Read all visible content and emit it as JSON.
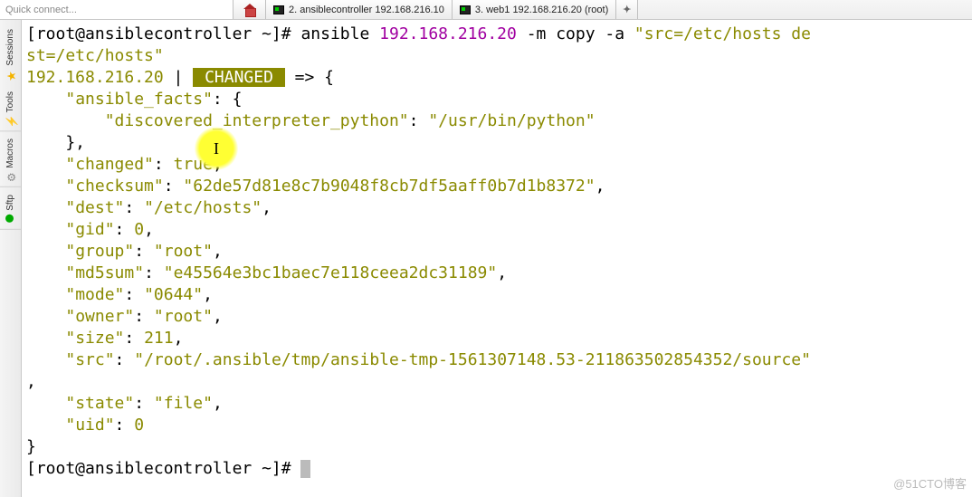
{
  "tabbar": {
    "quick_connect_placeholder": "Quick connect...",
    "tab2": "2. ansiblecontroller 192.168.216.10",
    "tab3": "3. web1 192.168.216.20 (root)",
    "newtab": "✦"
  },
  "sidebar": {
    "sessions": "Sessions",
    "tools": "Tools",
    "macros": "Macros",
    "sftp": "Sftp"
  },
  "term": {
    "prompt1a": "[root@ansiblecontroller ~]# ",
    "cmd_name": "ansible ",
    "cmd_ip": "192.168.216.20",
    "cmd_rest1": " -m copy -a ",
    "cmd_q1": "\"src=/etc/hosts de",
    "cmd_q2": "st=/etc/hosts\"",
    "resp_ip": "192.168.216.20",
    "pipe": " | ",
    "changed": " CHANGED ",
    "arrow": " => {",
    "k_facts": "\"ansible_facts\"",
    "open_facts": ": {",
    "k_disc": "\"discovered_interpreter_python\"",
    "v_disc": "\"/usr/bin/python\"",
    "close_facts": "    },",
    "k_changed": "\"changed\"",
    "v_changed": "true",
    "k_checksum": "\"checksum\"",
    "v_checksum": "\"62de57d81e8c7b9048f8cb7df5aaff0b7d1b8372\"",
    "k_dest": "\"dest\"",
    "v_dest": "\"/etc/hosts\"",
    "k_gid": "\"gid\"",
    "v_gid": "0",
    "k_group": "\"group\"",
    "v_group": "\"root\"",
    "k_md5": "\"md5sum\"",
    "v_md5": "\"e45564e3bc1baec7e118ceea2dc31189\"",
    "k_mode": "\"mode\"",
    "v_mode": "\"0644\"",
    "k_owner": "\"owner\"",
    "v_owner": "\"root\"",
    "k_size": "\"size\"",
    "v_size": "211",
    "k_src": "\"src\"",
    "v_src": "\"/root/.ansible/tmp/ansible-tmp-1561307148.53-211863502854352/source\"",
    "k_state": "\"state\"",
    "v_state": "\"file\"",
    "k_uid": "\"uid\"",
    "v_uid": "0",
    "close": "}",
    "prompt2": "[root@ansiblecontroller ~]# "
  },
  "watermark": "@51CTO博客",
  "cursor_glyph": "I"
}
